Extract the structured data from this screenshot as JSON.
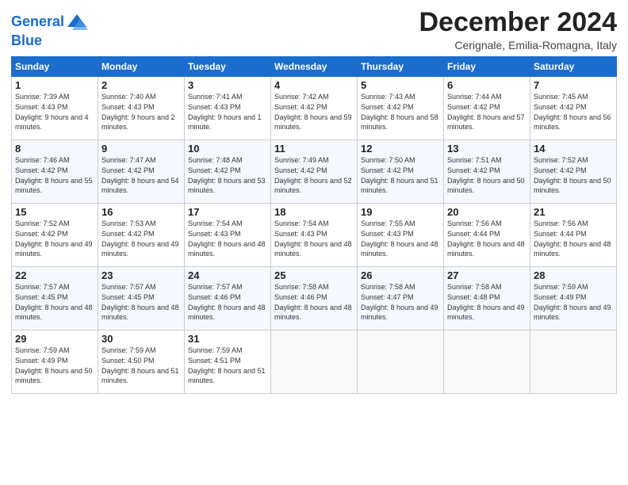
{
  "logo": {
    "line1": "General",
    "line2": "Blue"
  },
  "title": "December 2024",
  "location": "Cerignale, Emilia-Romagna, Italy",
  "days_of_week": [
    "Sunday",
    "Monday",
    "Tuesday",
    "Wednesday",
    "Thursday",
    "Friday",
    "Saturday"
  ],
  "weeks": [
    [
      {
        "day": "1",
        "sunrise": "Sunrise: 7:39 AM",
        "sunset": "Sunset: 4:43 PM",
        "daylight": "Daylight: 9 hours and 4 minutes."
      },
      {
        "day": "2",
        "sunrise": "Sunrise: 7:40 AM",
        "sunset": "Sunset: 4:43 PM",
        "daylight": "Daylight: 9 hours and 2 minutes."
      },
      {
        "day": "3",
        "sunrise": "Sunrise: 7:41 AM",
        "sunset": "Sunset: 4:43 PM",
        "daylight": "Daylight: 9 hours and 1 minute."
      },
      {
        "day": "4",
        "sunrise": "Sunrise: 7:42 AM",
        "sunset": "Sunset: 4:42 PM",
        "daylight": "Daylight: 8 hours and 59 minutes."
      },
      {
        "day": "5",
        "sunrise": "Sunrise: 7:43 AM",
        "sunset": "Sunset: 4:42 PM",
        "daylight": "Daylight: 8 hours and 58 minutes."
      },
      {
        "day": "6",
        "sunrise": "Sunrise: 7:44 AM",
        "sunset": "Sunset: 4:42 PM",
        "daylight": "Daylight: 8 hours and 57 minutes."
      },
      {
        "day": "7",
        "sunrise": "Sunrise: 7:45 AM",
        "sunset": "Sunset: 4:42 PM",
        "daylight": "Daylight: 8 hours and 56 minutes."
      }
    ],
    [
      {
        "day": "8",
        "sunrise": "Sunrise: 7:46 AM",
        "sunset": "Sunset: 4:42 PM",
        "daylight": "Daylight: 8 hours and 55 minutes."
      },
      {
        "day": "9",
        "sunrise": "Sunrise: 7:47 AM",
        "sunset": "Sunset: 4:42 PM",
        "daylight": "Daylight: 8 hours and 54 minutes."
      },
      {
        "day": "10",
        "sunrise": "Sunrise: 7:48 AM",
        "sunset": "Sunset: 4:42 PM",
        "daylight": "Daylight: 8 hours and 53 minutes."
      },
      {
        "day": "11",
        "sunrise": "Sunrise: 7:49 AM",
        "sunset": "Sunset: 4:42 PM",
        "daylight": "Daylight: 8 hours and 52 minutes."
      },
      {
        "day": "12",
        "sunrise": "Sunrise: 7:50 AM",
        "sunset": "Sunset: 4:42 PM",
        "daylight": "Daylight: 8 hours and 51 minutes."
      },
      {
        "day": "13",
        "sunrise": "Sunrise: 7:51 AM",
        "sunset": "Sunset: 4:42 PM",
        "daylight": "Daylight: 8 hours and 50 minutes."
      },
      {
        "day": "14",
        "sunrise": "Sunrise: 7:52 AM",
        "sunset": "Sunset: 4:42 PM",
        "daylight": "Daylight: 8 hours and 50 minutes."
      }
    ],
    [
      {
        "day": "15",
        "sunrise": "Sunrise: 7:52 AM",
        "sunset": "Sunset: 4:42 PM",
        "daylight": "Daylight: 8 hours and 49 minutes."
      },
      {
        "day": "16",
        "sunrise": "Sunrise: 7:53 AM",
        "sunset": "Sunset: 4:42 PM",
        "daylight": "Daylight: 8 hours and 49 minutes."
      },
      {
        "day": "17",
        "sunrise": "Sunrise: 7:54 AM",
        "sunset": "Sunset: 4:43 PM",
        "daylight": "Daylight: 8 hours and 48 minutes."
      },
      {
        "day": "18",
        "sunrise": "Sunrise: 7:54 AM",
        "sunset": "Sunset: 4:43 PM",
        "daylight": "Daylight: 8 hours and 48 minutes."
      },
      {
        "day": "19",
        "sunrise": "Sunrise: 7:55 AM",
        "sunset": "Sunset: 4:43 PM",
        "daylight": "Daylight: 8 hours and 48 minutes."
      },
      {
        "day": "20",
        "sunrise": "Sunrise: 7:56 AM",
        "sunset": "Sunset: 4:44 PM",
        "daylight": "Daylight: 8 hours and 48 minutes."
      },
      {
        "day": "21",
        "sunrise": "Sunrise: 7:56 AM",
        "sunset": "Sunset: 4:44 PM",
        "daylight": "Daylight: 8 hours and 48 minutes."
      }
    ],
    [
      {
        "day": "22",
        "sunrise": "Sunrise: 7:57 AM",
        "sunset": "Sunset: 4:45 PM",
        "daylight": "Daylight: 8 hours and 48 minutes."
      },
      {
        "day": "23",
        "sunrise": "Sunrise: 7:57 AM",
        "sunset": "Sunset: 4:45 PM",
        "daylight": "Daylight: 8 hours and 48 minutes."
      },
      {
        "day": "24",
        "sunrise": "Sunrise: 7:57 AM",
        "sunset": "Sunset: 4:46 PM",
        "daylight": "Daylight: 8 hours and 48 minutes."
      },
      {
        "day": "25",
        "sunrise": "Sunrise: 7:58 AM",
        "sunset": "Sunset: 4:46 PM",
        "daylight": "Daylight: 8 hours and 48 minutes."
      },
      {
        "day": "26",
        "sunrise": "Sunrise: 7:58 AM",
        "sunset": "Sunset: 4:47 PM",
        "daylight": "Daylight: 8 hours and 49 minutes."
      },
      {
        "day": "27",
        "sunrise": "Sunrise: 7:58 AM",
        "sunset": "Sunset: 4:48 PM",
        "daylight": "Daylight: 8 hours and 49 minutes."
      },
      {
        "day": "28",
        "sunrise": "Sunrise: 7:59 AM",
        "sunset": "Sunset: 4:49 PM",
        "daylight": "Daylight: 8 hours and 49 minutes."
      }
    ],
    [
      {
        "day": "29",
        "sunrise": "Sunrise: 7:59 AM",
        "sunset": "Sunset: 4:49 PM",
        "daylight": "Daylight: 8 hours and 50 minutes."
      },
      {
        "day": "30",
        "sunrise": "Sunrise: 7:59 AM",
        "sunset": "Sunset: 4:50 PM",
        "daylight": "Daylight: 8 hours and 51 minutes."
      },
      {
        "day": "31",
        "sunrise": "Sunrise: 7:59 AM",
        "sunset": "Sunset: 4:51 PM",
        "daylight": "Daylight: 8 hours and 51 minutes."
      },
      null,
      null,
      null,
      null
    ]
  ]
}
